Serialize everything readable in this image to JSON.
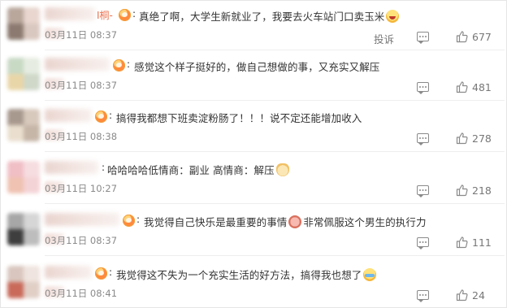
{
  "actions": {
    "report_label": "投诉"
  },
  "colors": {
    "text": "#333333",
    "meta": "#8a8a8a",
    "accent_name": "#eb7350",
    "divider": "#eeeeee"
  },
  "comments": [
    {
      "name_fragment": "I桐-",
      "text": "真绝了啊，大学生新就业了，我要去火车站门口卖玉米",
      "emoji": "laugh-emoji",
      "date": "03月11日 08:37",
      "likes": "677"
    },
    {
      "text": "感觉这个样子挺好的，做自己想做的事，又充实又解压",
      "date": "03月11日 08:37",
      "likes": "481"
    },
    {
      "text": "搞得我都想下班卖淀粉肠了！！！说不定还能增加收入",
      "date": "03月11日 08:38",
      "likes": "278"
    },
    {
      "text": "哈哈哈哈低情商：副业 高情商：解压",
      "emoji": "cat-emoji",
      "date": "03月11日 10:27",
      "likes": "218"
    },
    {
      "text_before": "我觉得自己快乐是最重要的事情",
      "emoji": "pig-emoji",
      "text_after": "非常佩服这个男生的执行力",
      "date": "03月11日 08:37",
      "likes": "111"
    },
    {
      "text": "我觉得这不失为一个充实生活的好方法，搞得我也想了",
      "emoji": "cry-laugh-emoji",
      "date": "03月11日 08:41",
      "likes": "24"
    }
  ]
}
